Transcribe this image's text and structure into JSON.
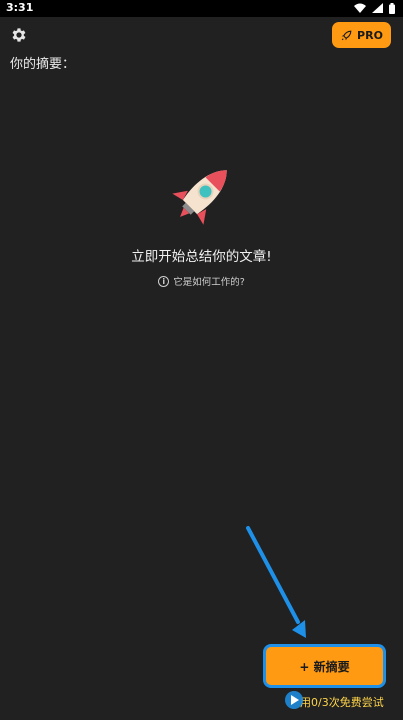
{
  "status_bar": {
    "time": "3:31"
  },
  "header": {
    "pro_label": "PRO",
    "summary_label": "你的摘要："
  },
  "empty_state": {
    "title": "立即开始总结你的文章!",
    "how_link": "它是如何工作的?"
  },
  "footer": {
    "new_summary_label": "+ 新摘要",
    "free_trials_text": "用0/3次免费尝试"
  },
  "colors": {
    "background": "#212121",
    "accent": "#ff9a12",
    "highlight": "#1e90e8",
    "rocket_body": "#f6e3cf",
    "rocket_fins": "#e8505b",
    "rocket_window": "#3fc1c0"
  }
}
